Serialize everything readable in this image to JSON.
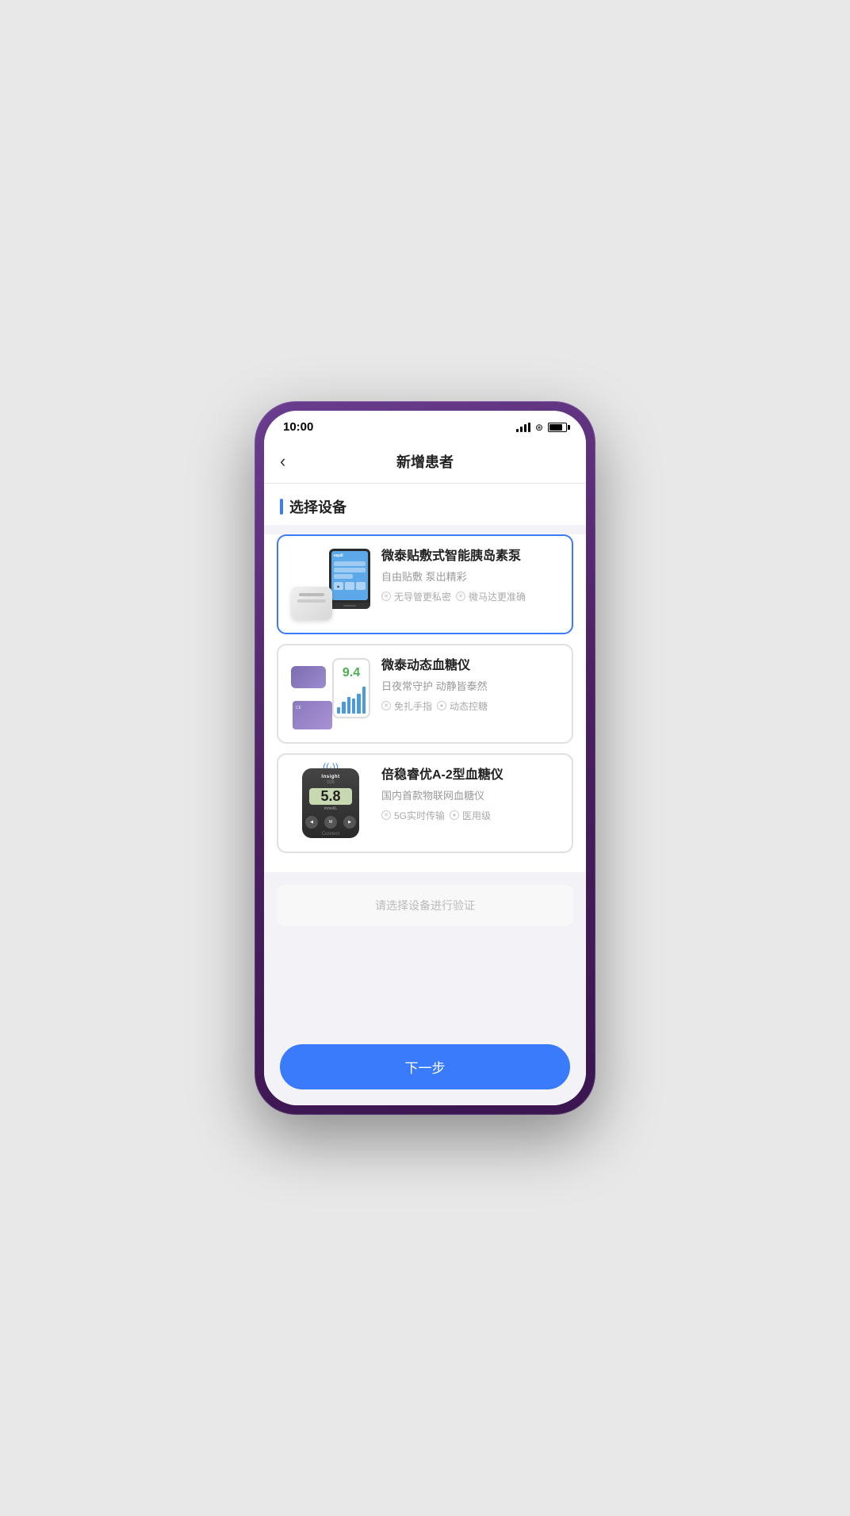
{
  "status_bar": {
    "time": "10:00"
  },
  "header": {
    "back_label": "‹",
    "title": "新增患者"
  },
  "section": {
    "title": "选择设备"
  },
  "devices": [
    {
      "id": "insulin-pump",
      "name": "微泰贴敷式智能胰岛素泵",
      "slogan": "自由贴敷  泵出精彩",
      "features": [
        "无导管更私密",
        "微马达更准确"
      ],
      "selected": true,
      "screen_value": "equil"
    },
    {
      "id": "cgm",
      "name": "微泰动态血糖仪",
      "slogan": "日夜常守护  动静皆泰然",
      "features": [
        "免扎手指",
        "动态控糖"
      ],
      "selected": false,
      "reading": "9.4"
    },
    {
      "id": "bgm",
      "name": "倍稳睿优A-2型血糖仪",
      "slogan": "国内首款物联网血糖仪",
      "features": [
        "5G实时传输",
        "医用级"
      ],
      "selected": false,
      "screen_value": "5.8",
      "brand_label": "Insight",
      "model_label": "Connect"
    }
  ],
  "verify": {
    "placeholder_text": "请选择设备进行验证"
  },
  "next_button": {
    "label": "下一步"
  }
}
